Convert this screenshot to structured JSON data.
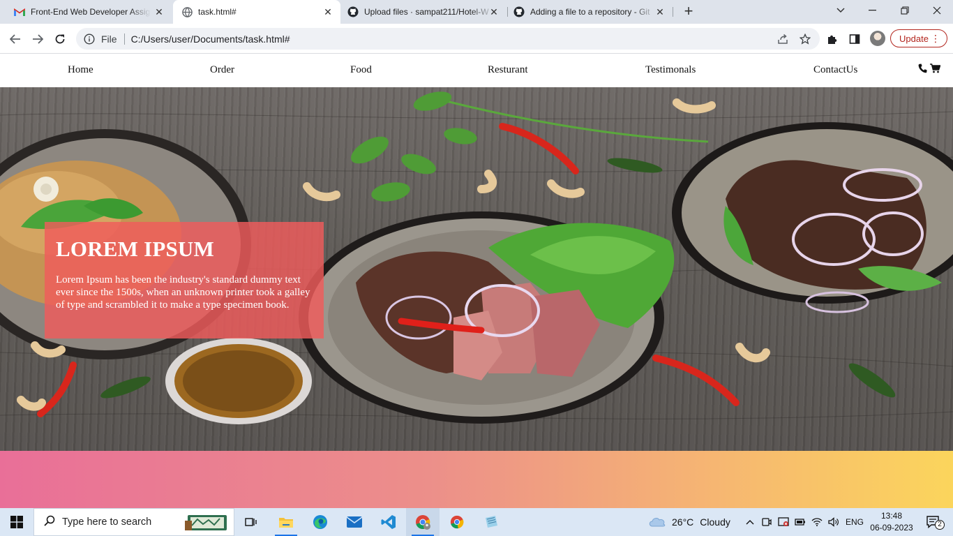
{
  "browser": {
    "tabs": [
      {
        "title": "Front-End Web Developer Assign",
        "icon": "gmail-icon",
        "active": false
      },
      {
        "title": "task.html#",
        "icon": "globe-icon",
        "active": true
      },
      {
        "title": "Upload files · sampat211/Hotel-W",
        "icon": "github-icon",
        "active": false
      },
      {
        "title": "Adding a file to a repository - Git",
        "icon": "github-icon",
        "active": false
      }
    ],
    "new_tab": "+",
    "address": {
      "scheme_label": "File",
      "url": "C:/Users/user/Documents/task.html#"
    },
    "update_label": "Update"
  },
  "site": {
    "nav": {
      "items": [
        "Home",
        "Order",
        "Food",
        "Resturant",
        "Testimonals",
        "ContactUs"
      ],
      "icons": [
        "phone-icon",
        "cart-icon"
      ]
    },
    "hero": {
      "title": "LOREM IPSUM",
      "body": "Lorem Ipsum has been the industry's standard dummy text ever since the 1500s, when an unknown printer took a galley of type and scrambled it to make a type specimen book.",
      "box_color": "#f05c5c"
    },
    "band_colors": [
      "#e96f98",
      "#fbd55c"
    ]
  },
  "taskbar": {
    "search_placeholder": "Type here to search",
    "weather": {
      "temp": "26°C",
      "condition": "Cloudy"
    },
    "language": "ENG",
    "time": "13:48",
    "date": "06-09-2023",
    "notifications": "2"
  }
}
